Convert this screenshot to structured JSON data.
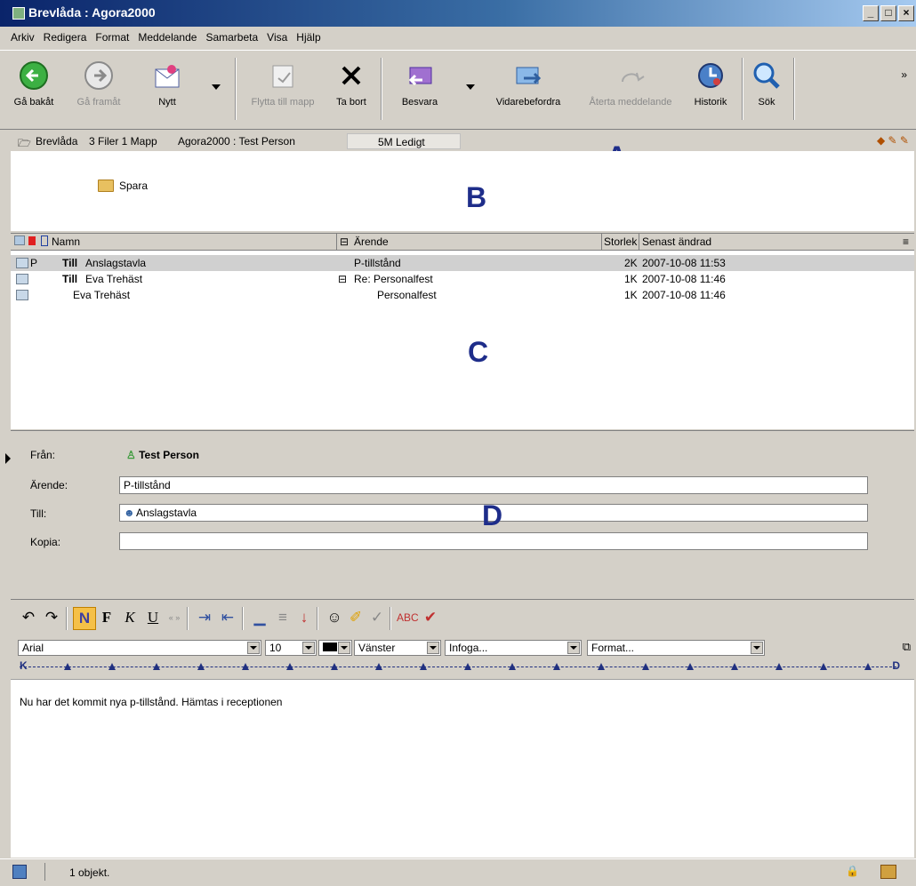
{
  "window": {
    "title": "Brevlåda : Agora2000",
    "minimize": "_",
    "restore": "□",
    "close": "×"
  },
  "menu": [
    "Arkiv",
    "Redigera",
    "Format",
    "Meddelande",
    "Samarbeta",
    "Visa",
    "Hjälp"
  ],
  "toolbar": {
    "back": "Gå bakåt",
    "forward": "Gå framåt",
    "new": "Nytt",
    "move": "Flytta till mapp",
    "delete": "Ta bort",
    "reply": "Besvara",
    "forward_msg": "Vidarebefordra",
    "recall": "Återta meddelande",
    "history": "Historik",
    "search": "Sök"
  },
  "pathbar": {
    "mailbox": "Brevlåda",
    "counts": "3 Filer 1 Mapp",
    "user": "Agora2000 : Test Person",
    "free": "5M Ledigt"
  },
  "markers": {
    "a": "A",
    "b": "B",
    "c": "C",
    "d": "D"
  },
  "folders": [
    {
      "name": "Spara"
    }
  ],
  "list": {
    "headers": {
      "name": "Namn",
      "subject": "Ärende",
      "size": "Storlek",
      "modified": "Senast ändrad"
    },
    "rows": [
      {
        "flag": "P",
        "prefix": "Till",
        "name": "Anslagstavla",
        "collapse": "",
        "subject": "P-tillstånd",
        "size": "2K",
        "modified": "2007-10-08 11:53"
      },
      {
        "flag": "",
        "prefix": "Till",
        "name": "Eva Trehäst",
        "collapse": "⊟",
        "subject": "Re: Personalfest",
        "size": "1K",
        "modified": "2007-10-08 11:46"
      },
      {
        "flag": "",
        "prefix": "",
        "name": "Eva Trehäst",
        "collapse": "",
        "subject": "Personalfest",
        "size": "1K",
        "modified": "2007-10-08 11:46"
      }
    ]
  },
  "message": {
    "from_label": "Från:",
    "from_value": "Test Person",
    "subject_label": "Ärende:",
    "subject_value": "P-tillstånd",
    "to_label": "Till:",
    "to_value": "Anslagstavla",
    "cc_label": "Kopia:",
    "cc_value": ""
  },
  "format": {
    "bold": "N",
    "b2": "F",
    "italic": "K",
    "underline": "U",
    "font": "Arial",
    "size": "10",
    "align": "Vänster",
    "insert": "Infoga...",
    "style": "Format..."
  },
  "body_text": "Nu har det kommit nya p-tillstånd. Hämtas i receptionen",
  "status": {
    "text": "1 objekt."
  }
}
